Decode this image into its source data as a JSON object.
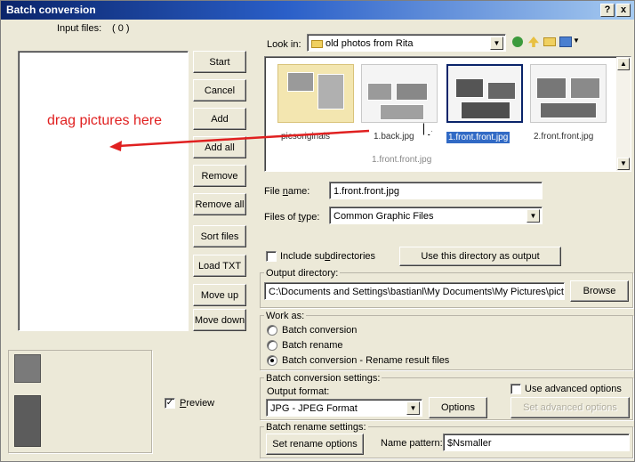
{
  "window": {
    "title": "Batch conversion",
    "help_button": "?",
    "close_button": "x"
  },
  "input_files": {
    "label": "Input files:",
    "count": "( 0 )",
    "drag_hint": "drag pictures here"
  },
  "buttons": {
    "start": "Start",
    "cancel": "Cancel",
    "add": "Add",
    "add_all": "Add all",
    "remove": "Remove",
    "remove_all": "Remove all",
    "sort_files": "Sort files",
    "load_txt": "Load TXT",
    "move_up": "Move up",
    "move_down": "Move down"
  },
  "preview": {
    "label": "Preview",
    "checked": true
  },
  "browser": {
    "look_in_label": "Look in:",
    "look_in_value": "old photos from Rita",
    "files": [
      {
        "name": "picsoriginals",
        "selected": false
      },
      {
        "name": "1.back.jpg",
        "selected": false
      },
      {
        "name": "1.front.front.jpg",
        "selected": true
      },
      {
        "name": "2.front.front.jpg",
        "selected": false
      }
    ],
    "drag_ghost": "1.front.front.jpg",
    "file_name_label": "File name:",
    "file_name_value": "1.front.front.jpg",
    "files_of_type_label": "Files of type:",
    "files_of_type_value": "Common Graphic Files"
  },
  "directory": {
    "include_subdirs_label": "Include subdirectories",
    "use_as_output": "Use this directory as output",
    "output_dir_label": "Output directory:",
    "output_dir_value": "C:\\Documents and Settings\\bastianl\\My Documents\\My Pictures\\pictur",
    "browse": "Browse"
  },
  "work_as": {
    "label": "Work as:",
    "options": [
      "Batch conversion",
      "Batch rename",
      "Batch conversion - Rename result files"
    ],
    "selected_index": 2
  },
  "conversion": {
    "settings_label": "Batch conversion settings:",
    "output_format_label": "Output format:",
    "output_format_value": "JPG - JPEG Format",
    "options_button": "Options",
    "use_advanced_label": "Use advanced options",
    "set_advanced_button": "Set advanced options"
  },
  "rename": {
    "settings_label": "Batch rename settings:",
    "set_rename_button": "Set rename options",
    "name_pattern_label": "Name pattern:",
    "name_pattern_value": "$Nsmaller"
  },
  "colors": {
    "selection": "#316ac5",
    "annotation": "#e02020"
  }
}
